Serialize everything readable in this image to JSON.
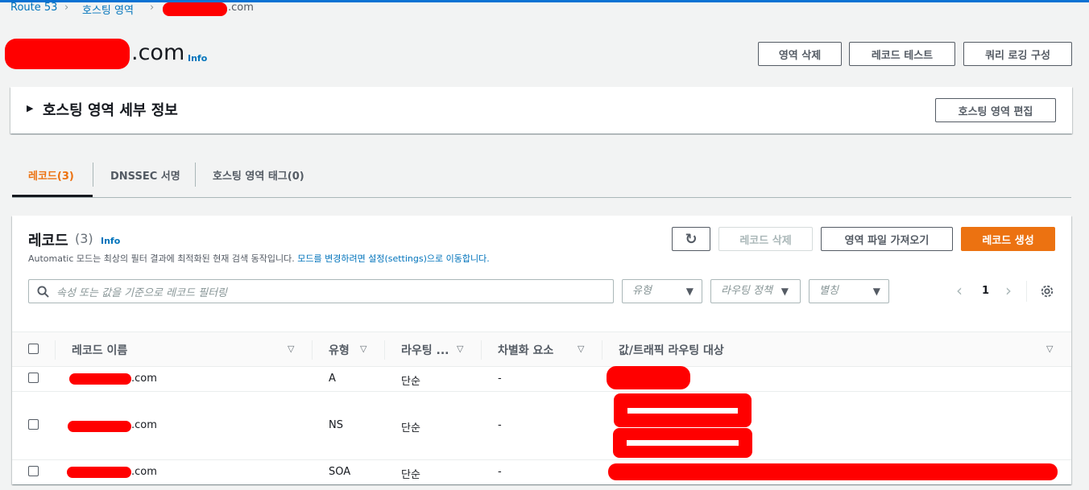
{
  "breadcrumb": {
    "items": [
      "Route 53",
      "호스팅 영역"
    ],
    "current_suffix": ".com"
  },
  "page": {
    "title_suffix": ".com",
    "info_label": "Info"
  },
  "header_buttons": {
    "delete_zone": "영역 삭제",
    "test_record": "레코드 테스트",
    "query_logging": "쿼리 로깅 구성"
  },
  "details_panel": {
    "title": "호스팅 영역 세부 정보",
    "edit_button": "호스팅 영역 편집"
  },
  "tabs": [
    {
      "label": "레코드(3)",
      "active": true
    },
    {
      "label": "DNSSEC 서명",
      "active": false
    },
    {
      "label": "호스팅 영역 태그(0)",
      "active": false
    }
  ],
  "records_panel": {
    "title": "레코드",
    "count": "(3)",
    "info_label": "Info",
    "description_plain": "Automatic 모드는 최상의 필터 결과에 최적화된 현재 검색 동작입니다.",
    "description_link": "모드를 변경하려면 설정(settings)으로 이동합니다.",
    "delete_button": "레코드 삭제",
    "import_button": "영역 파일 가져오기",
    "create_button": "레코드 생성",
    "search_placeholder": "속성 또는 값을 기준으로 레코드 필터링",
    "filter_type": "유형",
    "filter_routing": "라우팅 정책",
    "filter_alias": "별칭",
    "page_number": "1"
  },
  "table": {
    "columns": [
      "레코드 이름",
      "유형",
      "라우팅 ...",
      "차별화 요소",
      "값/트래픽 라우팅 대상"
    ],
    "rows": [
      {
        "name_suffix": ".com",
        "type": "A",
        "routing": "단순",
        "differentiator": "-"
      },
      {
        "name_suffix": ".com",
        "type": "NS",
        "routing": "단순",
        "differentiator": "-"
      },
      {
        "name_suffix": ".com",
        "type": "SOA",
        "routing": "단순",
        "differentiator": "-"
      }
    ]
  },
  "colors": {
    "accent": "#0073bb",
    "primary_button": "#ec7211",
    "active_tab": "#ec7211",
    "redaction": "#ff0000"
  },
  "icons": {
    "refresh": "refresh-icon",
    "search": "search-icon",
    "settings": "gear-icon",
    "prev": "chevron-left-icon",
    "next": "chevron-right-icon",
    "expand": "caret-right-icon",
    "dropdown": "caret-down-icon",
    "sort": "sort-icon"
  }
}
